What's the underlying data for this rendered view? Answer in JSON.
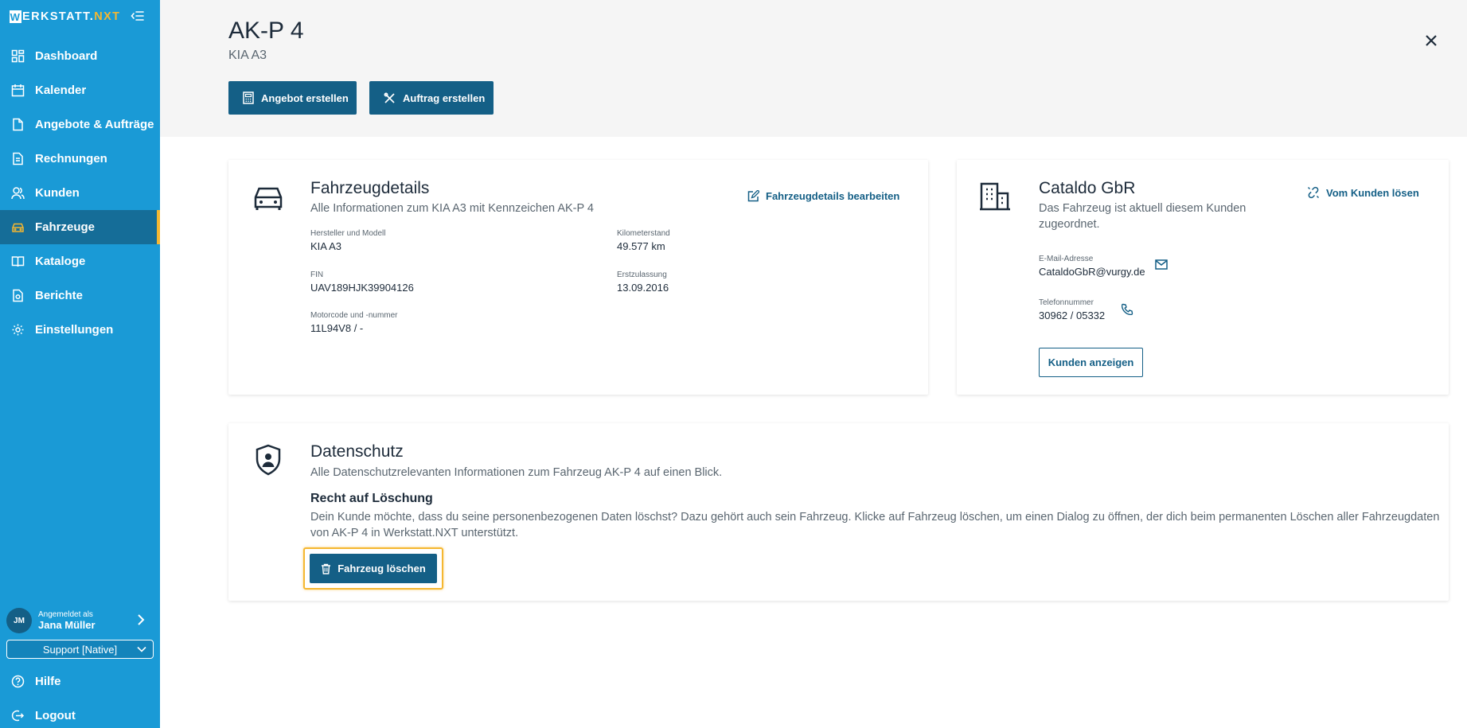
{
  "brand": {
    "logo_w": "W",
    "logo_rest": "ERKSTATT.",
    "logo_nxt": "NXT",
    "accent": "#f5b731",
    "sidebar_color": "#1a9ad6",
    "primary": "#145f86"
  },
  "sidebar": {
    "items": [
      {
        "label": "Dashboard",
        "icon": "dashboard-icon"
      },
      {
        "label": "Kalender",
        "icon": "calendar-icon"
      },
      {
        "label": "Angebote & Aufträge",
        "icon": "document-icon"
      },
      {
        "label": "Rechnungen",
        "icon": "invoice-icon"
      },
      {
        "label": "Kunden",
        "icon": "users-icon"
      },
      {
        "label": "Fahrzeuge",
        "icon": "car-icon",
        "active": true
      },
      {
        "label": "Kataloge",
        "icon": "book-icon"
      },
      {
        "label": "Berichte",
        "icon": "report-icon"
      },
      {
        "label": "Einstellungen",
        "icon": "gear-icon"
      }
    ],
    "user": {
      "initials": "JM",
      "caption": "Angemeldet als",
      "name": "Jana Müller"
    },
    "role": "Support [Native]",
    "help": "Hilfe",
    "logout": "Logout"
  },
  "header": {
    "title": "AK-P 4",
    "subtitle": "KIA A3",
    "offer_button": "Angebot erstellen",
    "order_button": "Auftrag erstellen"
  },
  "vehicle_card": {
    "title": "Fahrzeugdetails",
    "subtitle": "Alle Informationen zum KIA A3 mit Kennzeichen AK-P 4",
    "edit_link": "Fahrzeugdetails bearbeiten",
    "fields": {
      "model_label": "Hersteller und Modell",
      "model_value": "KIA A3",
      "km_label": "Kilometerstand",
      "km_value": "49.577 km",
      "fin_label": "FIN",
      "fin_value": "UAV189HJK39904126",
      "reg_label": "Erstzulassung",
      "reg_value": "13.09.2016",
      "engine_label": "Motorcode und -nummer",
      "engine_value": "11L94V8 / -"
    }
  },
  "customer_card": {
    "title": "Cataldo GbR",
    "subtitle_line1": "Das Fahrzeug ist aktuell diesem Kunden",
    "subtitle_line2": "zugeordnet.",
    "unlink": "Vom Kunden lösen",
    "email_label": "E-Mail-Adresse",
    "email_value": "CataldoGbR@vurgy.de",
    "phone_label": "Telefonnummer",
    "phone_value": "30962 / 05332",
    "show_button": "Kunden anzeigen"
  },
  "privacy_card": {
    "title": "Datenschutz",
    "subtitle": "Alle Datenschutzrelevanten Informationen zum Fahrzeug AK-P 4 auf einen Blick.",
    "section_title": "Recht auf Löschung",
    "text_line1": "Dein Kunde möchte, dass du seine personenbezogenen Daten löschst? Dazu gehört auch sein Fahrzeug. Klicke auf Fahrzeug löschen, um einen Dialog zu öffnen, der dich beim permanenten Löschen aller Fahrzeugdaten",
    "text_line2": "von AK-P 4 in Werkstatt.NXT unterstützt.",
    "delete_button": "Fahrzeug löschen"
  }
}
